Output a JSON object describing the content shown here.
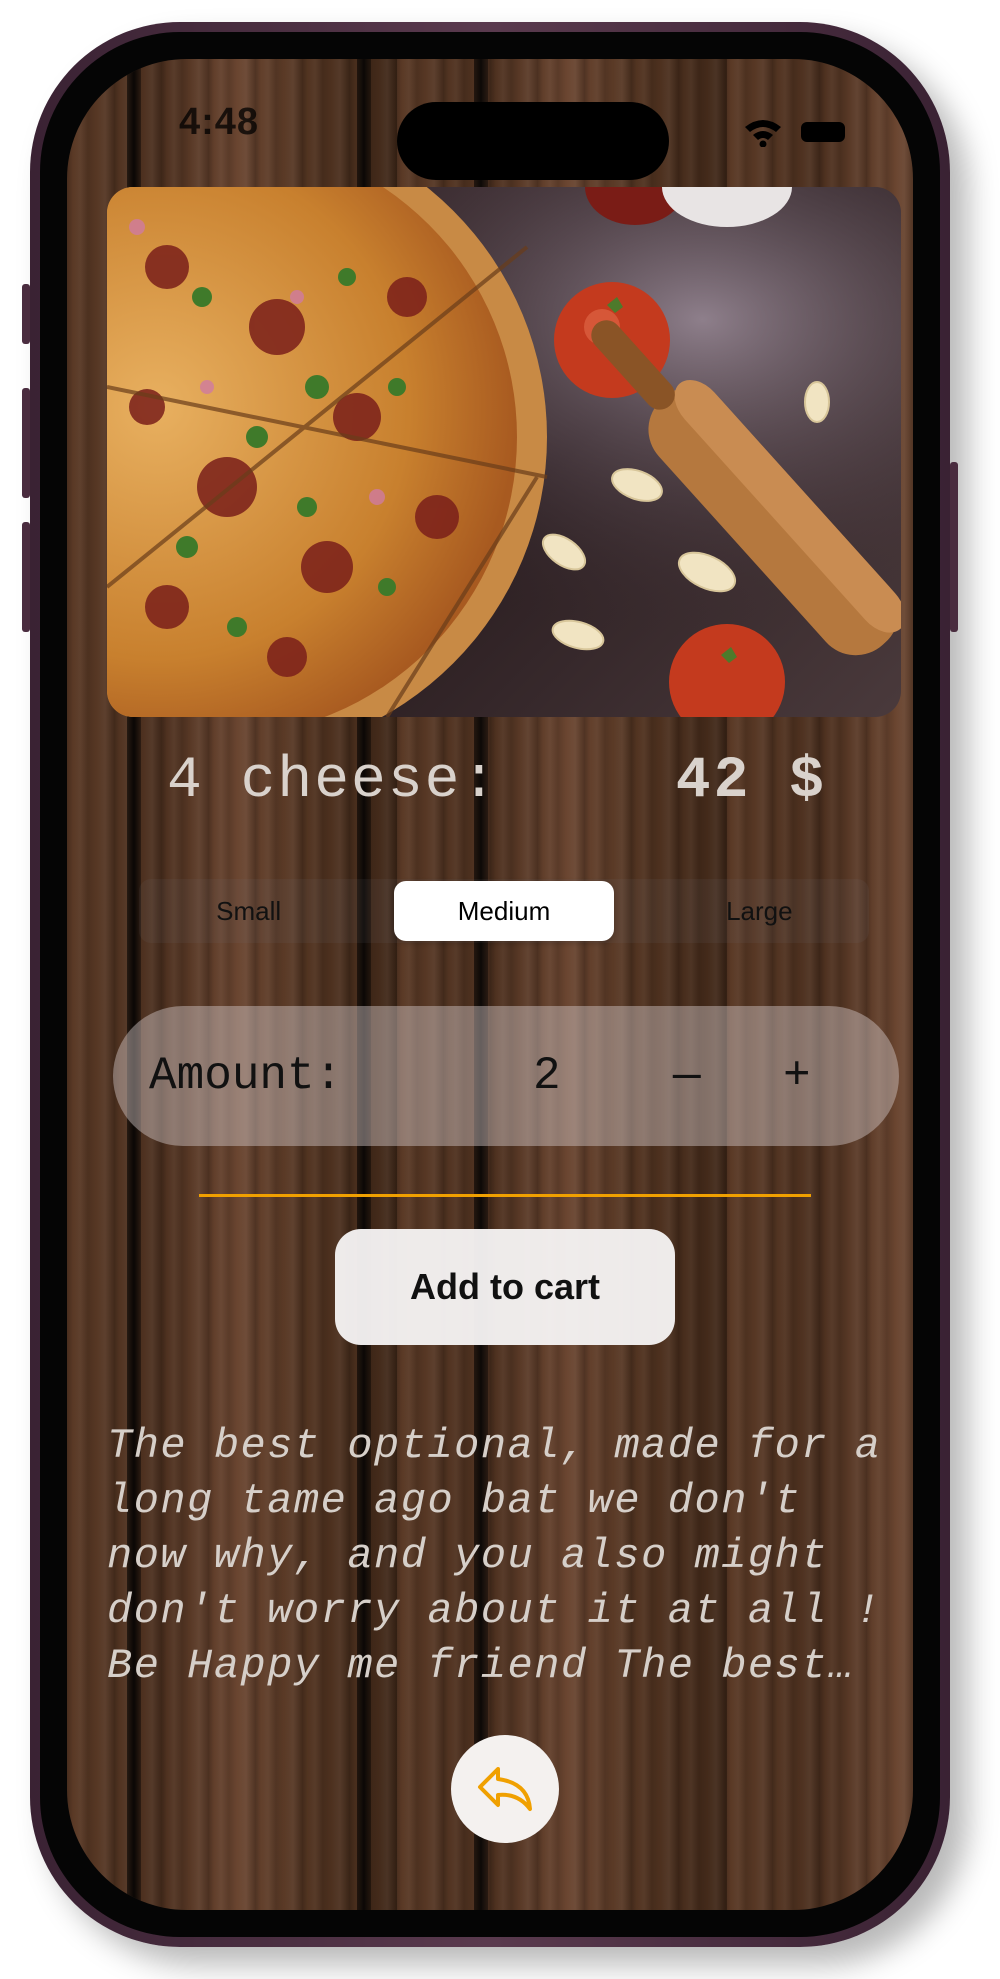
{
  "status_bar": {
    "time": "4:48",
    "wifi_icon": "wifi-icon",
    "battery_icon": "battery-icon"
  },
  "product": {
    "image_icon": "pizza-photo",
    "name": "4 cheese:",
    "price": "42 $"
  },
  "size_selector": {
    "options": [
      "Small",
      "Medium",
      "Large"
    ],
    "selected": "Medium"
  },
  "amount": {
    "label": "Amount:",
    "value": "2",
    "minus": "—",
    "plus": "+"
  },
  "divider_color": "#f0a000",
  "cart": {
    "button_label": "Add to cart"
  },
  "description": "The best optional, made for a long tame ago bat we don't now why, and you also might don't worry about it at all ! Be Happy me friend The best…",
  "back_button": {
    "icon": "arrow-uturn-left-icon",
    "color": "#f0a000"
  }
}
